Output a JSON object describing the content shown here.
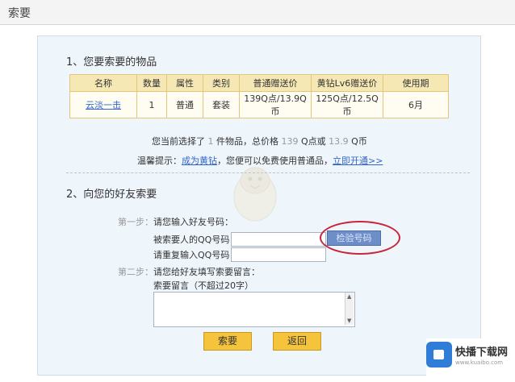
{
  "window": {
    "title": "索要"
  },
  "section1": {
    "heading": "1、您要索要的物品",
    "table": {
      "headers": [
        "名称",
        "数量",
        "属性",
        "类别",
        "普通赠送价",
        "黄钻Lv6赠送价",
        "使用期"
      ],
      "rows": [
        [
          "云淡一击",
          "1",
          "普通",
          "套装",
          "139Q点/13.9Q币",
          "125Q点/12.5Q币",
          "6月"
        ]
      ]
    },
    "summary": {
      "prefix": "您当前选择了",
      "count": "1",
      "mid": "件物品，总价格",
      "price_points": "139",
      "unit_points": "Q点或",
      "price_coins": "13.9",
      "unit_coins": "Q币"
    },
    "tip": {
      "label": "温馨提示：",
      "link1": "成为黄钻",
      "text": "，您便可以免费使用普通品，",
      "link2": "立即开通>>"
    }
  },
  "section2": {
    "heading": "2、向您的好友索要",
    "step1": {
      "label": "第一步：",
      "text": "请您输入好友号码："
    },
    "qq_label": "被索要人的QQ号码",
    "qq_value": "",
    "qq_confirm_label": "请重复输入QQ号码",
    "qq_confirm_value": "",
    "verify_button": "检验号码",
    "step2": {
      "label": "第二步：",
      "text": "请您给好友填写索要留言："
    },
    "message_label": "索要留言（不超过20字）",
    "message_value": ""
  },
  "buttons": {
    "submit": "索要",
    "back": "返回"
  },
  "watermark": {
    "name": "快播下载网",
    "url": "www.kuaibo.com"
  },
  "colors": {
    "table_header": "#f6e8b4",
    "button": "#f5c43c",
    "verify_button": "#6d8ec8",
    "highlight_circle": "#c8243a"
  }
}
